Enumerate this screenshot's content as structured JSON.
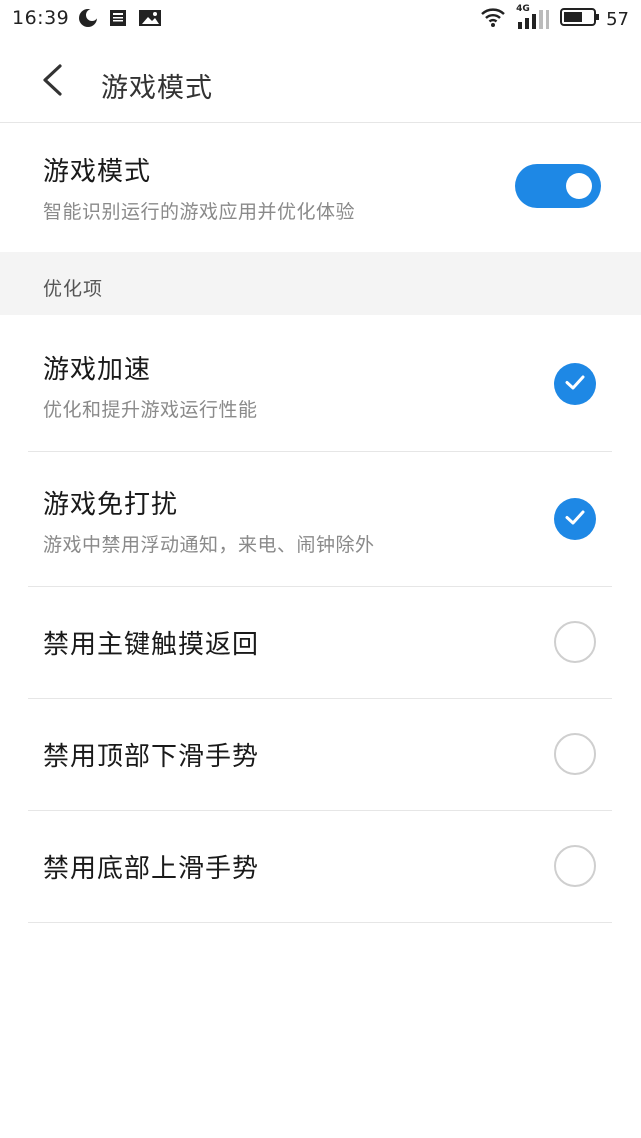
{
  "status_bar": {
    "time": "16:39",
    "battery": "57",
    "network": "4G"
  },
  "header": {
    "title": "游戏模式"
  },
  "game_mode": {
    "title": "游戏模式",
    "subtitle": "智能识别运行的游戏应用并优化体验",
    "enabled": true
  },
  "section": {
    "header": "优化项"
  },
  "options": [
    {
      "title": "游戏加速",
      "subtitle": "优化和提升游戏运行性能",
      "checked": true
    },
    {
      "title": "游戏免打扰",
      "subtitle": "游戏中禁用浮动通知，来电、闹钟除外",
      "checked": true
    },
    {
      "title": "禁用主键触摸返回",
      "checked": false
    },
    {
      "title": "禁用顶部下滑手势",
      "checked": false
    },
    {
      "title": "禁用底部上滑手势",
      "checked": false
    }
  ],
  "colors": {
    "accent": "#1e88e5",
    "unchecked_border": "#cfcfcf",
    "section_bg": "#f4f4f4"
  }
}
